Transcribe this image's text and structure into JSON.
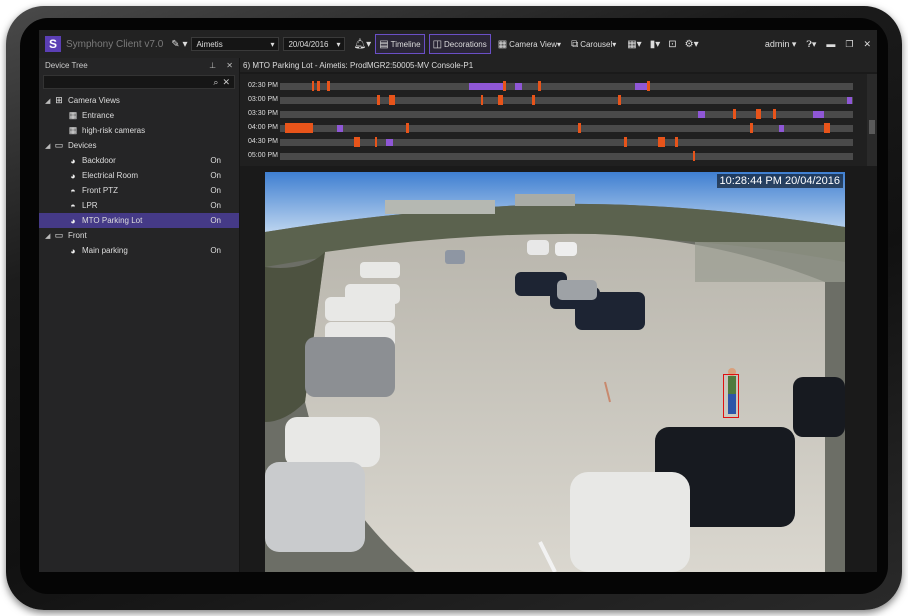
{
  "app": {
    "logo_letter": "S",
    "title": "Symphony Client v7.0",
    "brand_color": "#5b3fb5"
  },
  "toolbar": {
    "server_select": "Aimetis",
    "date_select": "20/04/2016",
    "timeline_label": "Timeline",
    "decorations_label": "Decorations",
    "camera_view_label": "Camera View",
    "carousel_label": "Carousel",
    "user_label": "admin",
    "icons": [
      "brush-icon",
      "bell-icon",
      "calendar-icon",
      "decorations-icon",
      "grid-icon",
      "carousel-icon",
      "layout-icon",
      "bookmark-icon",
      "screenshot-icon",
      "gear-icon",
      "help-icon",
      "minimize-icon",
      "restore-icon",
      "close-icon"
    ]
  },
  "device_tree": {
    "title": "Device Tree",
    "search_value": "",
    "items": [
      {
        "label": "Camera Views",
        "status": "",
        "level": 0,
        "icon": "camera-views-icon",
        "expander": "◢"
      },
      {
        "label": "Entrance",
        "status": "",
        "level": 1,
        "icon": "grid-icon"
      },
      {
        "label": "high-risk cameras",
        "status": "",
        "level": 1,
        "icon": "grid-icon"
      },
      {
        "label": "Devices",
        "status": "",
        "level": 0,
        "icon": "folder-icon",
        "expander": "◢"
      },
      {
        "label": "Backdoor",
        "status": "On",
        "level": 1,
        "icon": "camera-icon"
      },
      {
        "label": "Electrical Room",
        "status": "On",
        "level": 1,
        "icon": "camera-icon"
      },
      {
        "label": "Front PTZ",
        "status": "On",
        "level": 1,
        "icon": "ptz-camera-icon"
      },
      {
        "label": "LPR",
        "status": "On",
        "level": 1,
        "icon": "ptz-camera-icon"
      },
      {
        "label": "MTO Parking Lot",
        "status": "On",
        "level": 1,
        "icon": "camera-icon",
        "selected": true
      },
      {
        "label": "Front",
        "status": "",
        "level": 0,
        "icon": "folder-icon",
        "expander": "◢"
      },
      {
        "label": "Main parking",
        "status": "On",
        "level": 1,
        "icon": "camera-icon"
      }
    ]
  },
  "camera": {
    "title": "6) MTO Parking Lot - Aimetis: ProdMGR2:50005-MV Console-P1",
    "timestamp": "10:28:44 PM 20/04/2016"
  },
  "timeline": {
    "colors": {
      "motion": "#e8541a",
      "alarm": "#8f57d6",
      "track": "#4a4a4a"
    },
    "rows": [
      {
        "time": "02:30 PM",
        "marks": [
          [
            0.055,
            0.004,
            "m"
          ],
          [
            0.065,
            0.004,
            "m"
          ],
          [
            0.082,
            0.004,
            "m"
          ],
          [
            0.33,
            0.06,
            "a"
          ],
          [
            0.39,
            0.004,
            "m"
          ],
          [
            0.41,
            0.012,
            "a"
          ],
          [
            0.45,
            0.004,
            "m"
          ],
          [
            0.62,
            0.02,
            "a"
          ],
          [
            0.64,
            0.004,
            "m"
          ]
        ]
      },
      {
        "time": "03:00 PM",
        "marks": [
          [
            0.17,
            0.004,
            "m"
          ],
          [
            0.19,
            0.01,
            "m"
          ],
          [
            0.35,
            0.004,
            "m"
          ],
          [
            0.38,
            0.01,
            "m"
          ],
          [
            0.44,
            0.004,
            "m"
          ],
          [
            0.59,
            0.004,
            "m"
          ],
          [
            0.99,
            0.008,
            "a"
          ]
        ]
      },
      {
        "time": "03:30 PM",
        "marks": [
          [
            0.73,
            0.012,
            "a"
          ],
          [
            0.79,
            0.004,
            "m"
          ],
          [
            0.83,
            0.01,
            "m"
          ],
          [
            0.86,
            0.004,
            "m"
          ],
          [
            0.93,
            0.02,
            "a"
          ]
        ]
      },
      {
        "time": "04:00 PM",
        "marks": [
          [
            0.008,
            0.05,
            "m"
          ],
          [
            0.1,
            0.01,
            "a"
          ],
          [
            0.22,
            0.004,
            "m"
          ],
          [
            0.52,
            0.004,
            "m"
          ],
          [
            0.82,
            0.006,
            "m"
          ],
          [
            0.87,
            0.01,
            "a"
          ],
          [
            0.95,
            0.01,
            "m"
          ]
        ]
      },
      {
        "time": "04:30 PM",
        "marks": [
          [
            0.13,
            0.01,
            "m"
          ],
          [
            0.165,
            0.004,
            "m"
          ],
          [
            0.185,
            0.012,
            "a"
          ],
          [
            0.6,
            0.006,
            "m"
          ],
          [
            0.66,
            0.012,
            "m"
          ],
          [
            0.69,
            0.004,
            "m"
          ]
        ]
      },
      {
        "time": "05:00 PM",
        "marks": [
          [
            0.72,
            0.004,
            "m"
          ]
        ]
      }
    ]
  }
}
